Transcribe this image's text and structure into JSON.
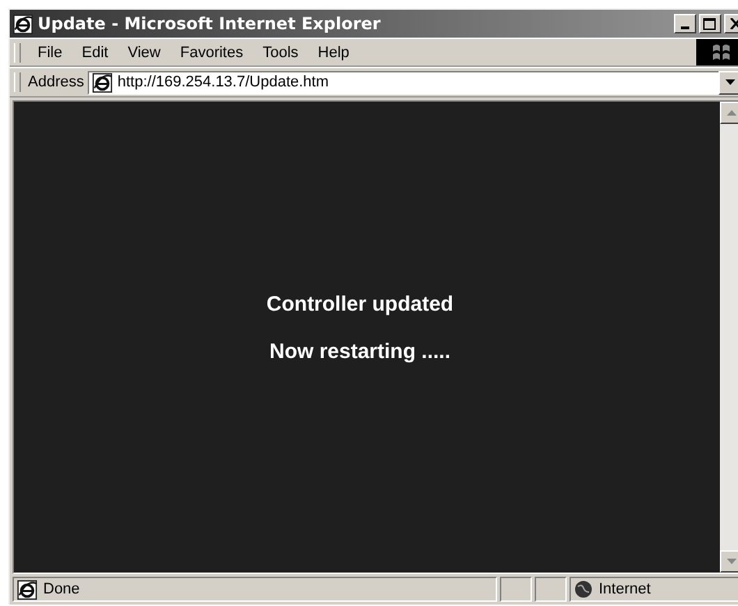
{
  "window": {
    "title": "Update - Microsoft Internet Explorer"
  },
  "menu": [
    "File",
    "Edit",
    "View",
    "Favorites",
    "Tools",
    "Help"
  ],
  "address": {
    "label": "Address",
    "value": "http://169.254.13.7/Update.htm"
  },
  "page": {
    "lines": [
      "Controller updated",
      "Now restarting ....."
    ]
  },
  "status_bar": {
    "text": "Done",
    "zone": "Internet"
  }
}
